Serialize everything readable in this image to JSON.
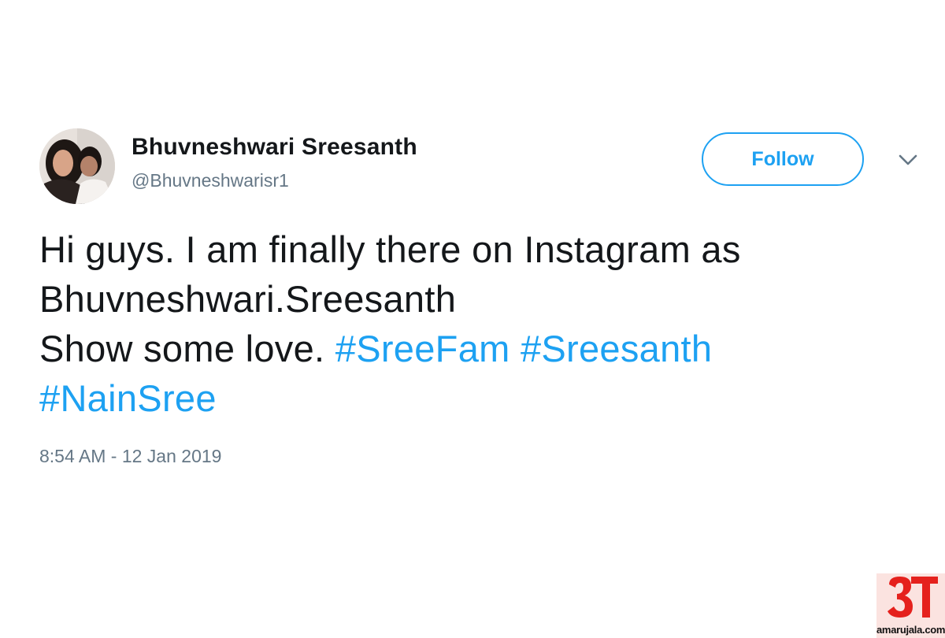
{
  "tweet": {
    "display_name": "Bhuvneshwari Sreesanth",
    "handle": "@Bhuvneshwarisr1",
    "follow_label": "Follow",
    "chevron_icon": "chevron-down-icon",
    "text_line_1": "Hi guys. I am finally there on Instagram as",
    "text_line_2": "Bhuvneshwari.Sreesanth",
    "text_line_3_plain": "Show some love. ",
    "hashtags": [
      "#SreeFam",
      "#Sreesanth",
      "#NainSree"
    ],
    "timestamp": "8:54 AM - 12 Jan 2019"
  },
  "watermark": {
    "logo_mark": "अ",
    "site": "amarujala.com"
  },
  "colors": {
    "accent": "#1da1f2",
    "text": "#14171a",
    "muted": "#657786",
    "watermark_red": "#e5211d",
    "watermark_bg": "#fbe3e0"
  }
}
